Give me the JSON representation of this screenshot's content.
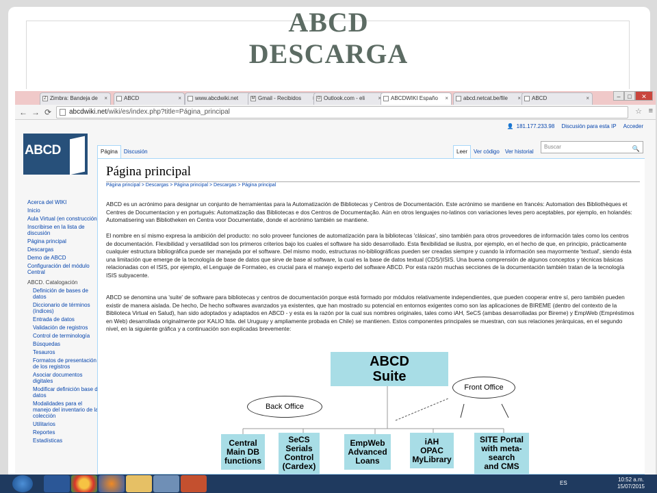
{
  "slide": {
    "title_line1": "ABCD",
    "title_line2": "DESCARGA"
  },
  "browser": {
    "tabs": [
      {
        "label": "Zimbra: Bandeja de",
        "fav": "Z",
        "active": false
      },
      {
        "label": "ABCD",
        "fav": "",
        "active": false
      },
      {
        "label": "www.abcdwiki.net",
        "fav": "",
        "active": false
      },
      {
        "label": "Gmail - Recibidos",
        "fav": "M",
        "active": false
      },
      {
        "label": "Outlook.com - eli",
        "fav": "O",
        "active": false
      },
      {
        "label": "ABCDWIKI Españo",
        "fav": "",
        "active": true
      },
      {
        "label": "abcd.netcat.be/file",
        "fav": "",
        "active": false
      },
      {
        "label": "ABCD",
        "fav": "",
        "active": false
      }
    ],
    "url_host": "abcdwiki.net",
    "url_path": "/wiki/es/index.php?title=Página_principal"
  },
  "wiki": {
    "userbar": {
      "ip": "181.177.233.98",
      "discussion": "Discusión para esta IP",
      "login": "Acceder"
    },
    "logo_text": "ABCD",
    "tabs_left": [
      "Página",
      "Discusión"
    ],
    "tabs_right": [
      "Leer",
      "Ver código",
      "Ver historial"
    ],
    "search_placeholder": "Buscar",
    "sidebar": {
      "items": [
        "Acerca del WIKI",
        "Inicio",
        "Aula Virtual (en construcción)",
        "Inscribirse en la lista de discusión",
        "Página principal",
        "Descargas",
        "Demo de ABCD",
        "Configuración del módulo Central"
      ],
      "section_head": "ABCD. Catalogación",
      "sub_items": [
        "Definición de bases de datos",
        "Diccionario de términos (índices)",
        "Entrada de datos",
        "Validación de registros",
        "Control de terminología",
        "Búsquedas",
        "Tesauros",
        "Formatos de presentación de los registros",
        "Asociar documentos digitales",
        "Modificar definición base de datos",
        "Modalidades para el manejo del inventario de la colección",
        "Utilitarios",
        "Reportes",
        "Estadísticas"
      ]
    },
    "heading": "Página principal",
    "breadcrumb": "Página principal > Descargas > Página principal > Descargas > Página principal",
    "paragraphs": [
      "ABCD es un acrónimo para designar un conjunto de herramientas para la Automatización de Bibliotecas y Centros de Documentación. Este acrónimo se mantiene en francés: Automation des Bibliothèques et Centres de Documentacion y en portugués: Automatização das Bibliotecas e dos Centros de Documentação. Aún en otros lenguajes no-latinos con variaciones leves pero aceptables, por ejemplo, en holandés: Automatisering van Bibliotheken en Centra voor Documentatie, donde el acrónimo también se mantiene.",
      "El nombre en sí mismo expresa la ambición del producto: no solo proveer funciones de automatización para la bibliotecas 'clásicas', sino también para otros proveedores de información tales como los centros de documentación. Flexibilidad y versatilidad son los primeros criterios bajo los cuales el software ha sido desarrollado. Esta flexibilidad se ilustra, por ejemplo, en el hecho de que, en principio, prácticamente cualquier estructura bibliográfica puede ser manejada por el software. Del mismo modo, estructuras no-bibliográficas pueden ser creadas siempre y cuando la información sea mayormente 'textual', siendo ésta una limitación que emerge de la tecnología de base de datos que sirve de base al software, la cual es la base de datos textual (CDS/)ISIS. Una buena comprensión de algunos conceptos y técnicas básicas relacionadas con el ISIS, por ejemplo, el Lenguaje de Formateo, es crucial para el manejo experto del software ABCD. Por esta razón muchas secciones de la documentación también tratan de la tecnología ISIS subyacente.",
      "ABCD se denomina una 'suite' de software para bibliotecas y centros de documentación porque está formado por módulos relativamente independientes, que pueden cooperar entre sí, pero también pueden existir de manera aislada. De hecho, De hecho softwares avanzados ya existentes, que han mostrado su potencial en entornos exigentes como son las aplicaciones de BIREME (dentro del contexto de la Biblioteca Virtual en Salud), han sido adoptados y adaptados en ABCD - y esta es la razón por la cual sus nombres originales, tales como iAH, SeCS (ambas desarrolladas por Bireme) y EmpWeb (Empréstimos en Web) desarrollada originalmente por KALIO ltda. del Uruguay y ampliamente probada en Chile) se mantienen. Estos componentes principales se muestran, con sus relaciones jerárquicas, en el segundo nivel, en la siguiente gráfica y a continuación son explicadas brevemente:"
    ],
    "diagram": {
      "suite_line1": "ABCD",
      "suite_line2": "Suite",
      "front_office": "Front Office",
      "back_office": "Back Office",
      "modules": [
        [
          "Central",
          "Main DB",
          "functions"
        ],
        [
          "SeCS",
          "Serials",
          "Control",
          "(Cardex)"
        ],
        [
          "EmpWeb",
          "Advanced",
          "Loans"
        ],
        [
          "iAH",
          "OPAC",
          "MyLibrary"
        ],
        [
          "SITE Portal",
          "with meta-",
          "search",
          "and CMS"
        ]
      ]
    }
  },
  "taskbar": {
    "lang": "ES",
    "time": "10:52 a.m.",
    "date": "15/07/2015"
  }
}
